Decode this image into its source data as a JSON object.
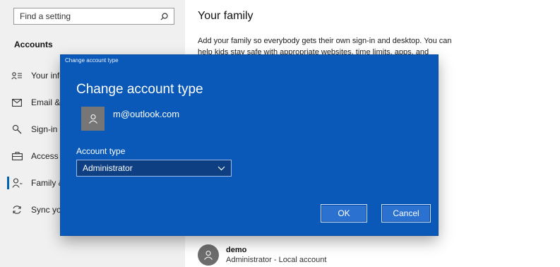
{
  "sidebar": {
    "search_placeholder": "Find a setting",
    "section_title": "Accounts",
    "items": [
      {
        "label": "Your info",
        "icon": "person-card-icon"
      },
      {
        "label": "Email & accounts",
        "icon": "mail-icon"
      },
      {
        "label": "Sign-in options",
        "icon": "key-icon"
      },
      {
        "label": "Access work or school",
        "icon": "briefcase-icon"
      },
      {
        "label": "Family & other users",
        "icon": "person-add-icon",
        "selected": true
      },
      {
        "label": "Sync your settings",
        "icon": "sync-icon"
      }
    ]
  },
  "main": {
    "title": "Your family",
    "description": "Add your family so everybody gets their own sign-in and desktop. You can help kids stay safe with appropriate websites, time limits, apps, and",
    "member": {
      "name": "demo",
      "role": "Administrator - Local account"
    }
  },
  "dialog": {
    "caption": "Change account type",
    "title": "Change account type",
    "email": "m@outlook.com",
    "account_type_label": "Account type",
    "account_type_value": "Administrator",
    "ok_label": "OK",
    "cancel_label": "Cancel"
  },
  "colors": {
    "dialog_bg": "#0a59b8",
    "accent": "#0063b1"
  }
}
